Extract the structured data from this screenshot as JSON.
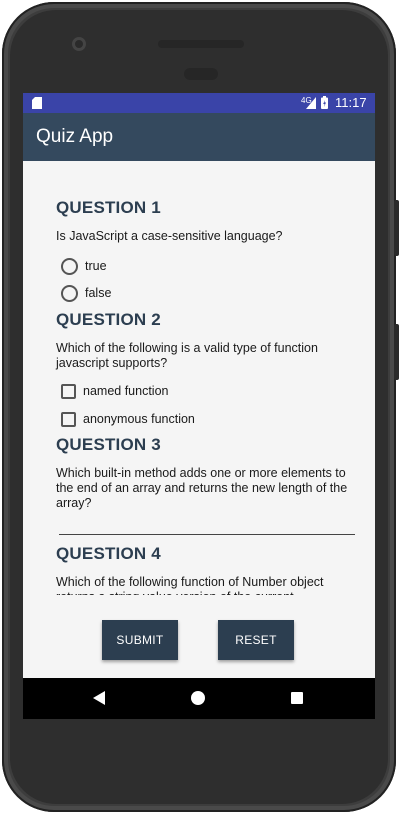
{
  "status_bar": {
    "network": "4G",
    "time": "11:17",
    "color": "#3a44a8"
  },
  "app_bar": {
    "title": "Quiz App",
    "color": "#34495e"
  },
  "questions": [
    {
      "title": "QUESTION 1",
      "text": "Is JavaScript a case-sensitive language?",
      "type": "radio",
      "options": [
        "true",
        "false"
      ]
    },
    {
      "title": "QUESTION 2",
      "text": "Which of the following is a valid type of function javascript supports?",
      "type": "checkbox",
      "options": [
        "named function",
        "anonymous function"
      ]
    },
    {
      "title": "QUESTION 3",
      "text": "Which built-in method adds one or more elements to the end of an array and returns the new length of the array?",
      "type": "text",
      "answer_value": ""
    },
    {
      "title": "QUESTION 4",
      "text": "Which of the following function of Number object returns a string value version of the current number?"
    }
  ],
  "buttons": {
    "submit": "SUBMIT",
    "reset": "RESET",
    "color": "#2c3e50"
  },
  "icons": {
    "status": [
      "sd-card-icon",
      "signal-icon",
      "battery-icon"
    ],
    "nav": [
      "back-icon",
      "home-icon",
      "recents-icon"
    ]
  }
}
